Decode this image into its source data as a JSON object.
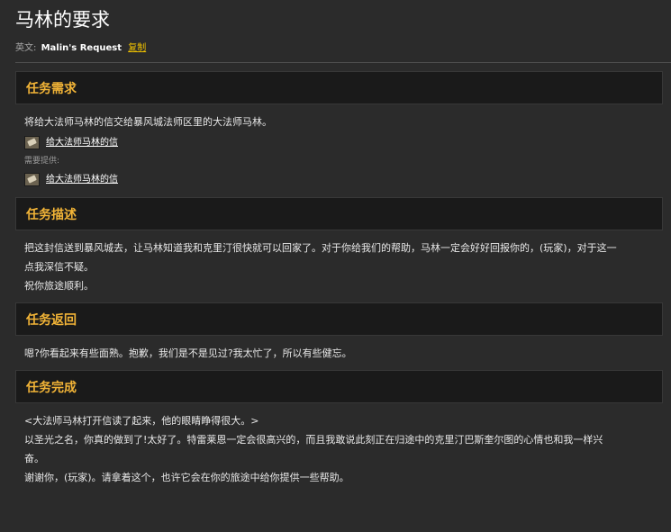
{
  "page": {
    "title": "马林的要求",
    "en_label": "英文:",
    "en_name": "Malin's Request",
    "copy_label": "复制"
  },
  "requirements": {
    "header": "任务需求",
    "text": "将给大法师马林的信交给暴风城法师区里的大法师马林。",
    "item_name": "给大法师马林的信",
    "provided_label": "需要提供:",
    "provided_item_name": "给大法师马林的信"
  },
  "description": {
    "header": "任务描述",
    "line1": "把这封信送到暴风城去，让马林知道我和克里汀很快就可以回家了。对于你给我们的帮助，马林一定会好好回报你的，(玩家)，对于这一",
    "line2": "点我深信不疑。",
    "line3": "祝你旅途顺利。"
  },
  "progress": {
    "header": "任务返回",
    "text": "嗯?你看起来有些面熟。抱歉，我们是不是见过?我太忙了，所以有些健忘。"
  },
  "completion": {
    "header": "任务完成",
    "line1": "<大法师马林打开信读了起来，他的眼睛睁得很大。>",
    "line2": "以圣光之名，你真的做到了!太好了。特雷莱恩一定会很高兴的，而且我敢说此刻正在归途中的克里汀巴斯奎尔图的心情也和我一样兴",
    "line3": "奋。",
    "line4": "谢谢你，(玩家)。请拿着这个，也许它会在你的旅途中给你提供一些帮助。"
  },
  "icons": {
    "item": "scroll-icon"
  },
  "colors": {
    "accent": "#f2b437",
    "background": "#2b2b2b",
    "header_bg": "#1a1a1a",
    "link": "#ffffff",
    "copy": "#f0c200"
  }
}
